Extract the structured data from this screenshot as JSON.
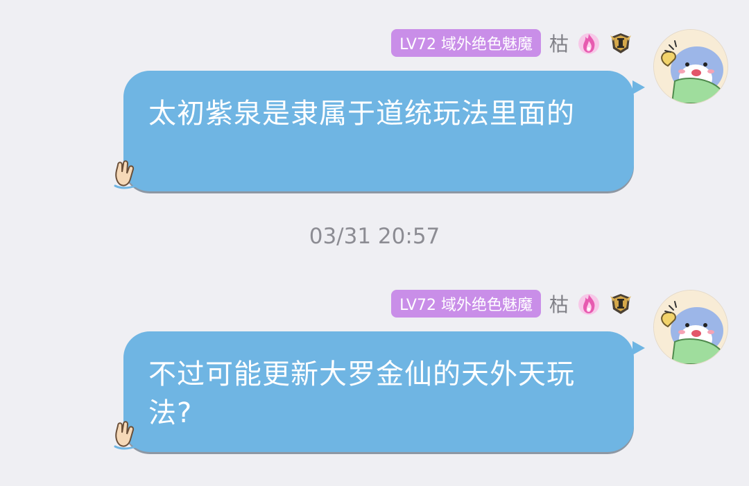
{
  "messages": [
    {
      "level_badge": "LV72 域外绝色魅魔",
      "nickname": "枯",
      "text": "太初紫泉是隶属于道统玩法里面的"
    },
    {
      "level_badge": "LV72 域外绝色魅魔",
      "nickname": "枯",
      "text": "不过可能更新大罗金仙的天外天玩法?"
    }
  ],
  "timestamp": "03/31 20:57",
  "icons": {
    "avatar": "avatar-icon",
    "medal_fire": "flame-medal-icon",
    "medal_rank": "rank-badge-icon",
    "bubble_decoration": "waving-hand-icon"
  },
  "colors": {
    "background": "#efeff3",
    "bubble": "#6fb5e3",
    "level_badge": "#c98ee8",
    "nickname": "#7f7f86",
    "timestamp": "#8c8c93"
  }
}
